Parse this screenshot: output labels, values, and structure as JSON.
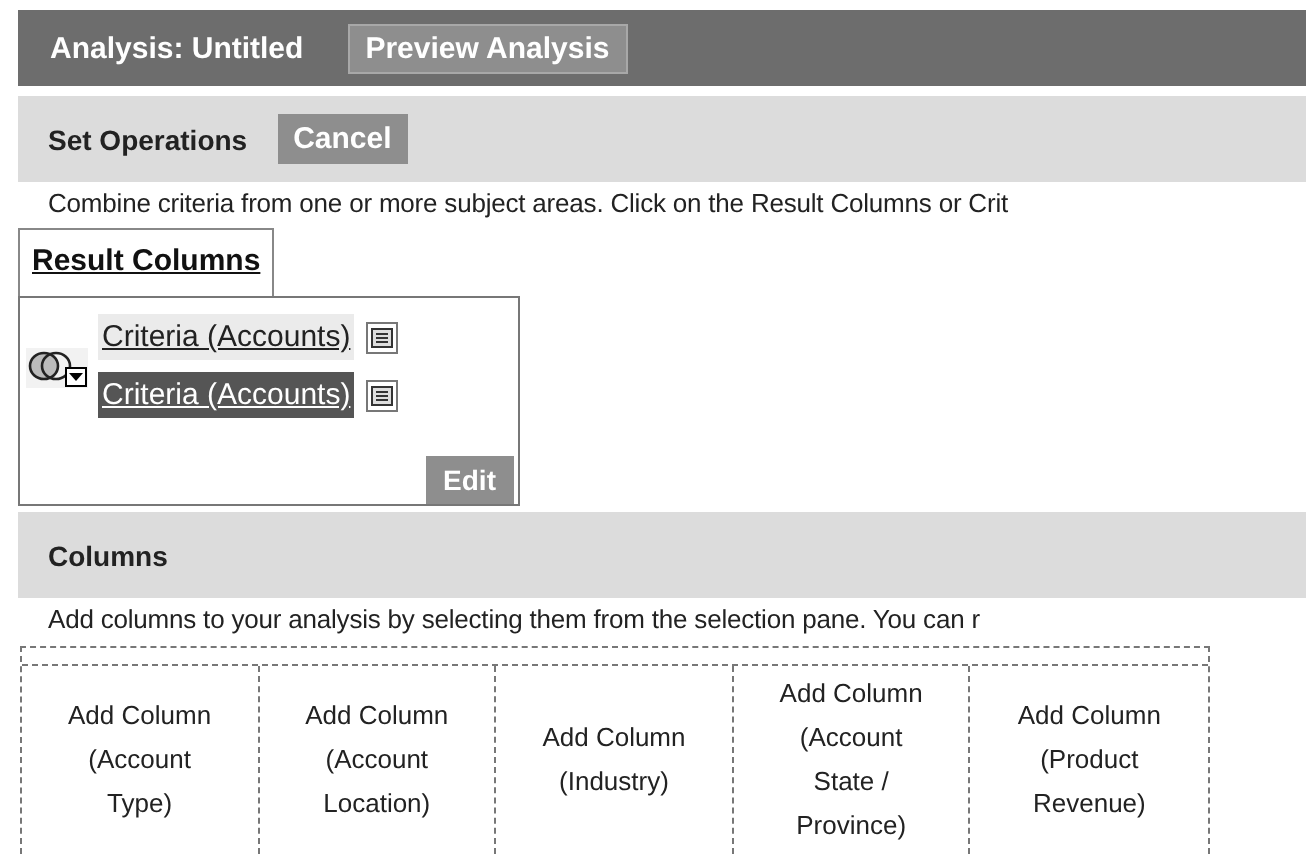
{
  "header": {
    "title": "Analysis: Untitled",
    "button": "Preview Analysis"
  },
  "set_operations": {
    "title": "Set Operations",
    "button": "Cancel",
    "description": "Combine criteria from one or more subject areas. Click on the Result Columns or Crit",
    "result_tab": "Result Columns",
    "criteria": [
      {
        "label": "Criteria (Accounts)",
        "selected": false
      },
      {
        "label": "Criteria (Accounts)",
        "selected": true
      }
    ],
    "edit_button": "Edit"
  },
  "columns": {
    "title": "Columns",
    "description": "Add columns to your analysis by selecting them from the selection pane. You can r",
    "slots": [
      {
        "lines": [
          "Add Column",
          "(Account",
          "Type)"
        ]
      },
      {
        "lines": [
          "Add Column",
          "(Account",
          "Location)"
        ]
      },
      {
        "lines": [
          "Add Column",
          "(Industry)"
        ]
      },
      {
        "lines": [
          "Add Column",
          "(Account",
          "State /",
          "Province)"
        ]
      },
      {
        "lines": [
          "Add Column",
          "(Product",
          "Revenue)"
        ]
      }
    ]
  }
}
